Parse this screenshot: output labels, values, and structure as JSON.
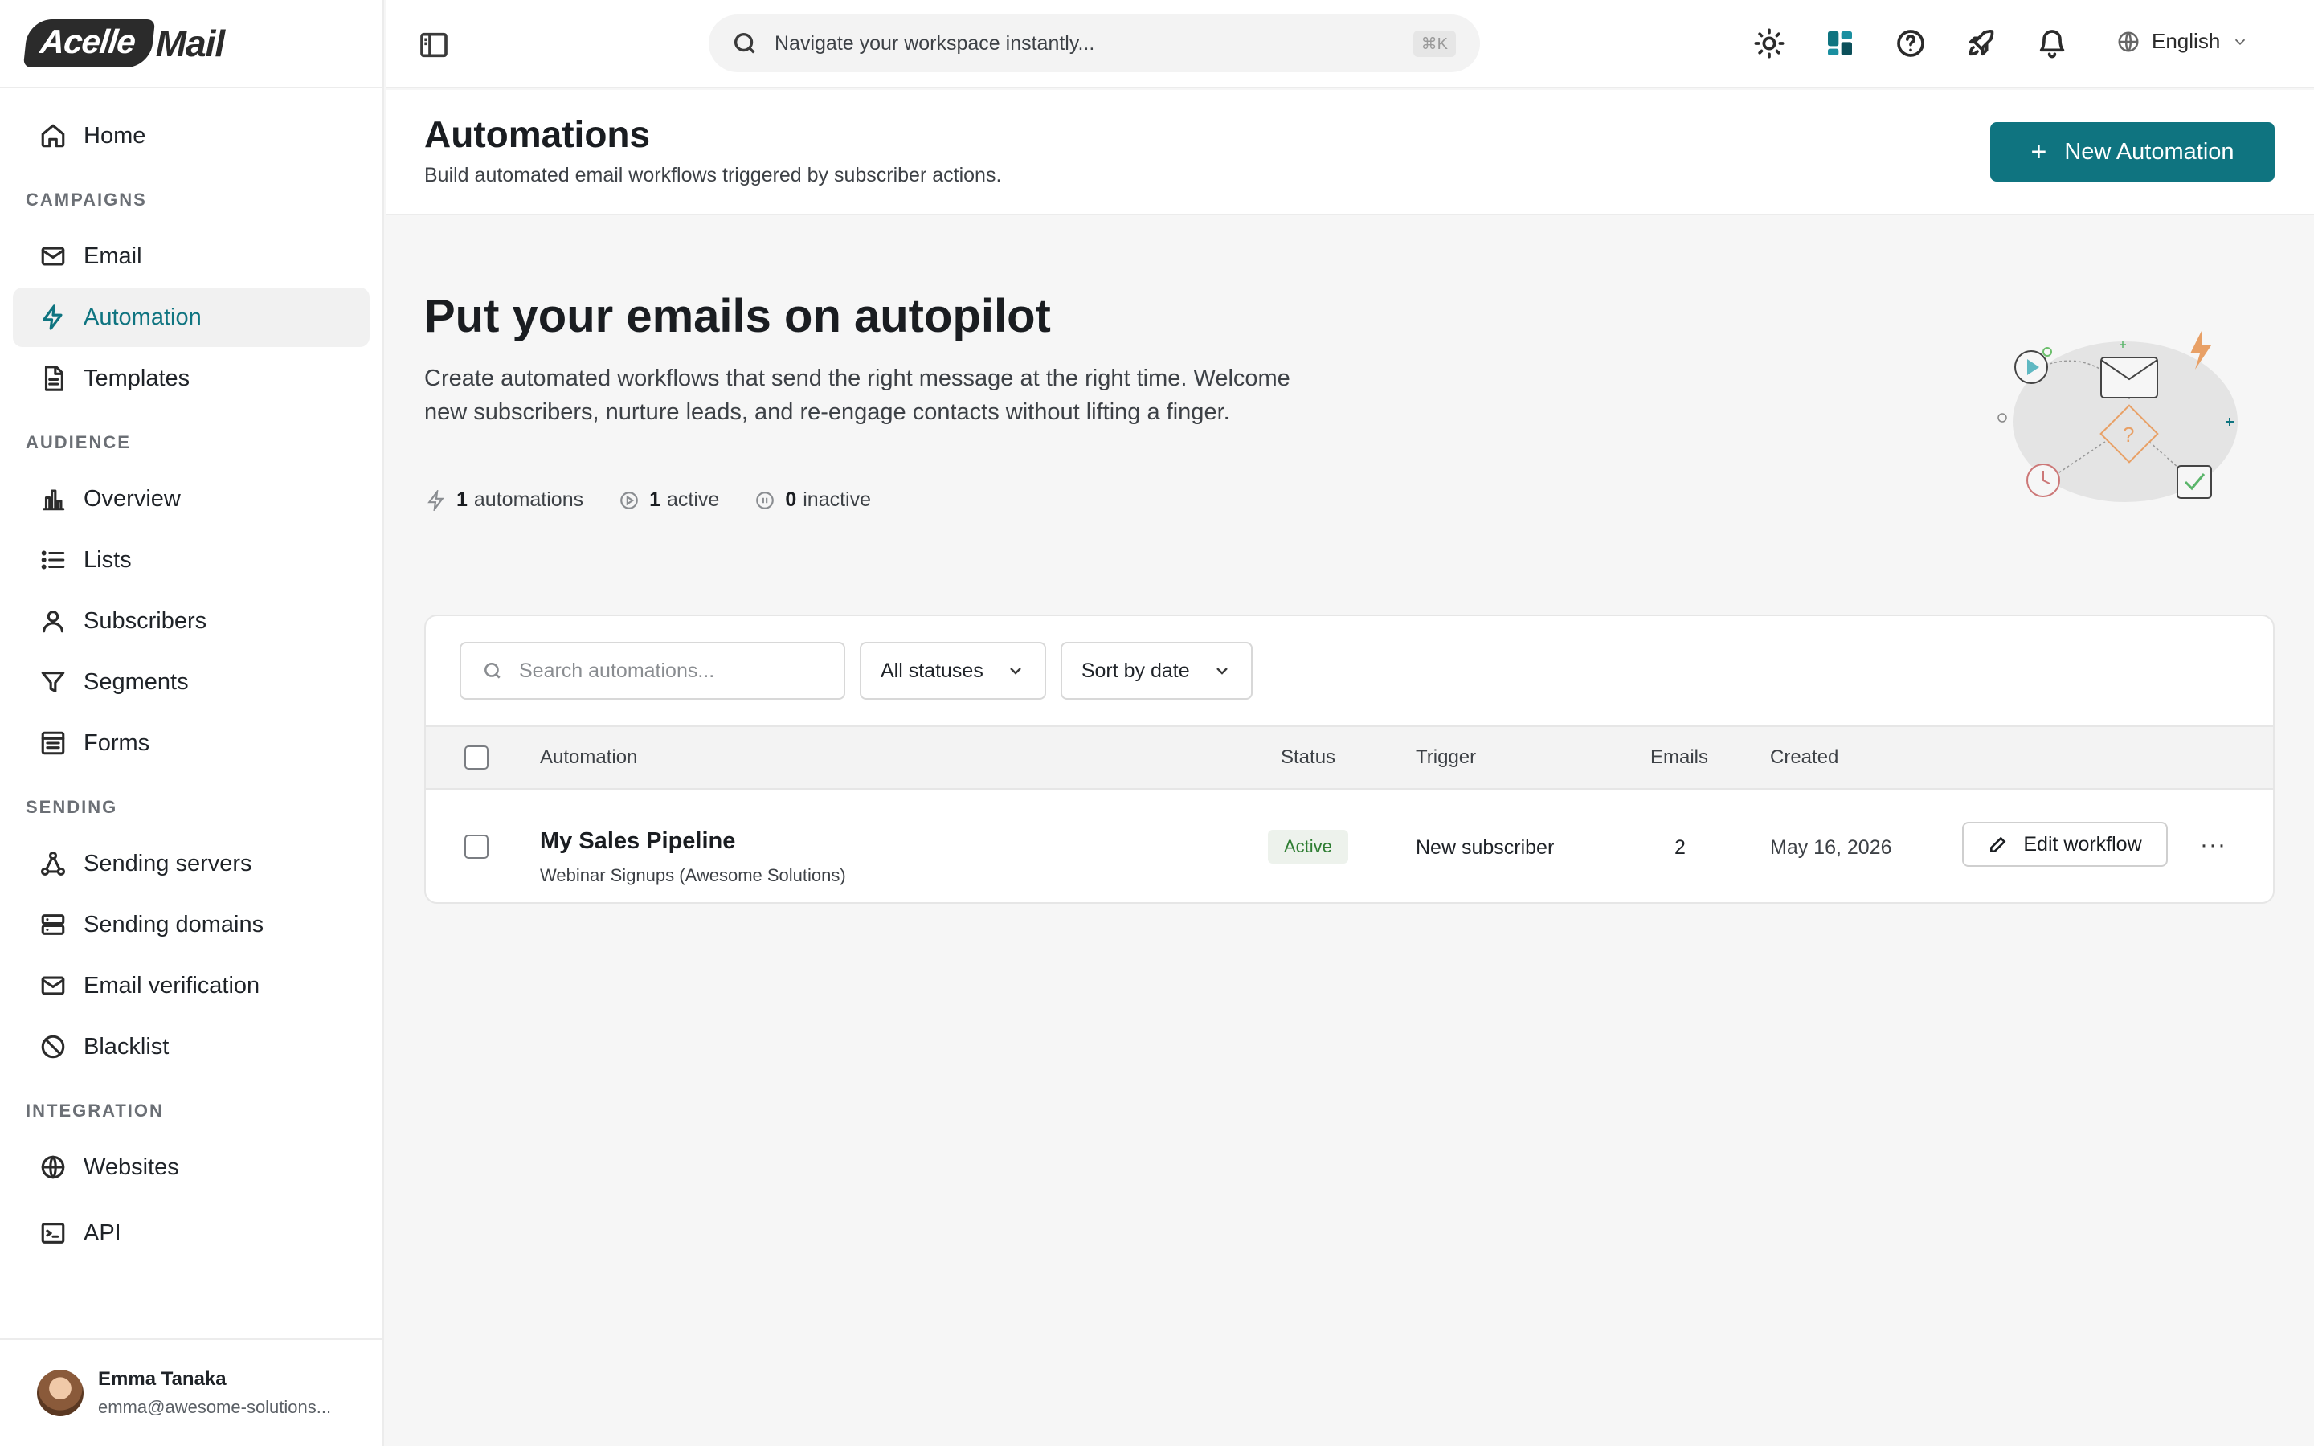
{
  "brand": {
    "logo_left": "Acelle",
    "logo_right": "Mail"
  },
  "sidebar": {
    "home": "Home",
    "sections": {
      "campaigns": "CAMPAIGNS",
      "audience": "AUDIENCE",
      "sending": "SENDING",
      "integration": "INTEGRATION"
    },
    "items": {
      "email": "Email",
      "automation": "Automation",
      "templates": "Templates",
      "overview": "Overview",
      "lists": "Lists",
      "subscribers": "Subscribers",
      "segments": "Segments",
      "forms": "Forms",
      "sending_servers": "Sending servers",
      "sending_domains": "Sending domains",
      "email_verification": "Email verification",
      "blacklist": "Blacklist",
      "websites": "Websites",
      "api": "API"
    },
    "active_item": "automation",
    "user": {
      "name": "Emma Tanaka",
      "email": "emma@awesome-solutions..."
    }
  },
  "topbar": {
    "search_placeholder": "Navigate your workspace instantly...",
    "shortcut": "⌘K",
    "language": "English"
  },
  "header": {
    "title": "Automations",
    "subtitle": "Build automated email workflows triggered by subscriber actions.",
    "new_button": "New Automation"
  },
  "hero": {
    "title": "Put your emails on autopilot",
    "description": "Create automated workflows that send the right message at the right time. Welcome new subscribers, nurture leads, and re-engage contacts without lifting a finger.",
    "stats": {
      "total_count": "1",
      "total_label": "automations",
      "active_count": "1",
      "active_label": "active",
      "inactive_count": "0",
      "inactive_label": "inactive"
    }
  },
  "filters": {
    "search_placeholder": "Search automations...",
    "status": "All statuses",
    "sort": "Sort by date"
  },
  "table": {
    "columns": {
      "automation": "Automation",
      "status": "Status",
      "trigger": "Trigger",
      "emails": "Emails",
      "created": "Created"
    },
    "rows": [
      {
        "name": "My Sales Pipeline",
        "list": "Webinar Signups (Awesome Solutions)",
        "status": "Active",
        "trigger": "New subscriber",
        "emails": "2",
        "created": "May 16, 2026",
        "edit_label": "Edit workflow",
        "more": "···"
      }
    ]
  },
  "colors": {
    "accent": "#0f7480",
    "active_badge_bg": "#edf2ec",
    "active_badge_text": "#2e7d32"
  }
}
